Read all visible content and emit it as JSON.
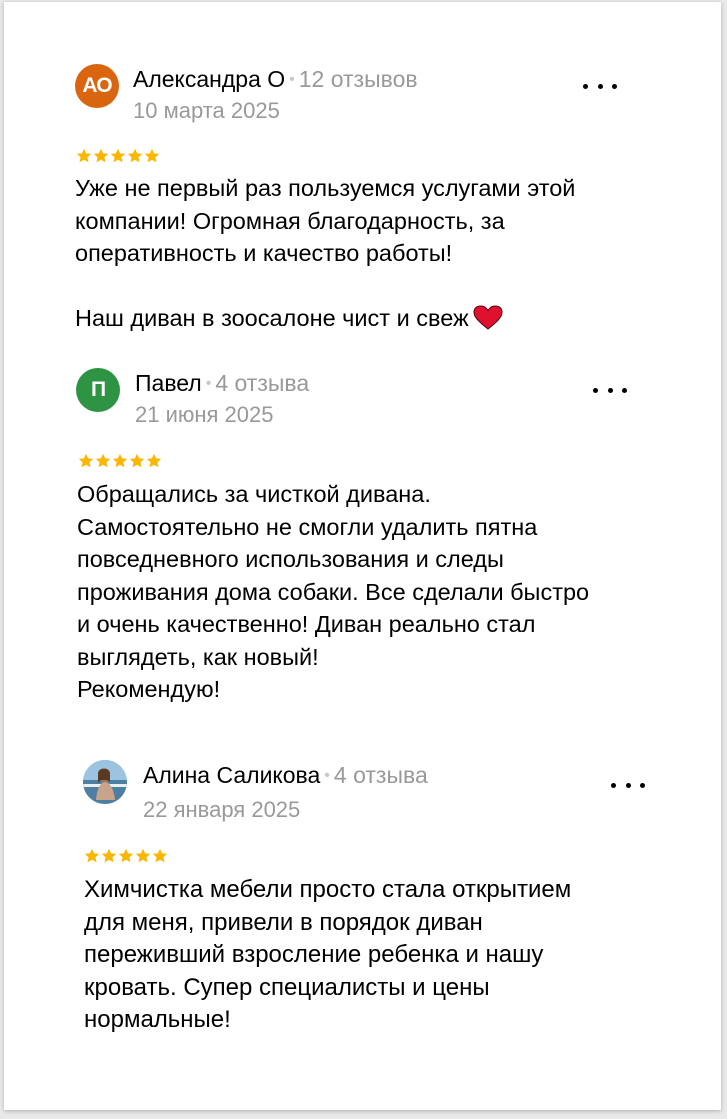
{
  "reviews": [
    {
      "initials": "АО",
      "avatar_color": "#d9660f",
      "name": "Александра О",
      "count": "12 отзывов",
      "date": "10 марта 2025",
      "rating": 5,
      "text": "Уже не первый раз пользуемся услугами этой\nкомпании! Огромная благодарность, за\nоперативность и качество работы!\n\nНаш диван в зоосалоне чист и свеж",
      "emoji": "heart-icon"
    },
    {
      "initials": "П",
      "avatar_color": "#2e9444",
      "name": "Павел",
      "count": "4 отзыва",
      "date": "21 июня 2025",
      "rating": 5,
      "text": "Обращались за чисткой дивана.\nСамостоятельно не смогли удалить пятна\nповседневного использования и следы\nпроживания дома собаки. Все сделали быстро\nи очень качественно! Диван реально стал\nвыглядеть, как новый!\nРекомендую!"
    },
    {
      "avatar": "photo",
      "name": "Алина Саликова",
      "count": "4 отзыва",
      "date": "22 января 2025",
      "rating": 5,
      "text": "Химчистка мебели просто стала открытием\nдля меня, привели в порядок диван\nпереживший взросление ребенка и нашу\nкровать. Супер специалисты и цены\nнормальные!"
    }
  ],
  "colors": {
    "star": "#fbb600",
    "heart": "#e0102f"
  }
}
